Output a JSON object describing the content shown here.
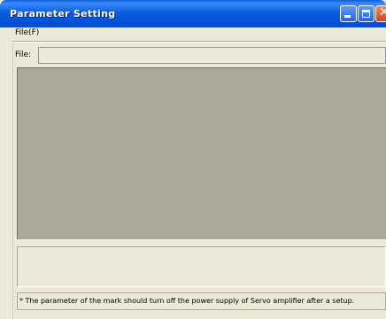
{
  "window": {
    "title": "Parameter Setting"
  },
  "menu": {
    "file_label": "File(F)"
  },
  "file": {
    "label": "File:",
    "value": ""
  },
  "status": {
    "note": "* The parameter of the mark should turn off the power supply of Servo amplifier after a setup."
  },
  "colors": {
    "titlebar": "#0a5fd8",
    "panel": "#aca899",
    "background": "#ece9d8"
  }
}
